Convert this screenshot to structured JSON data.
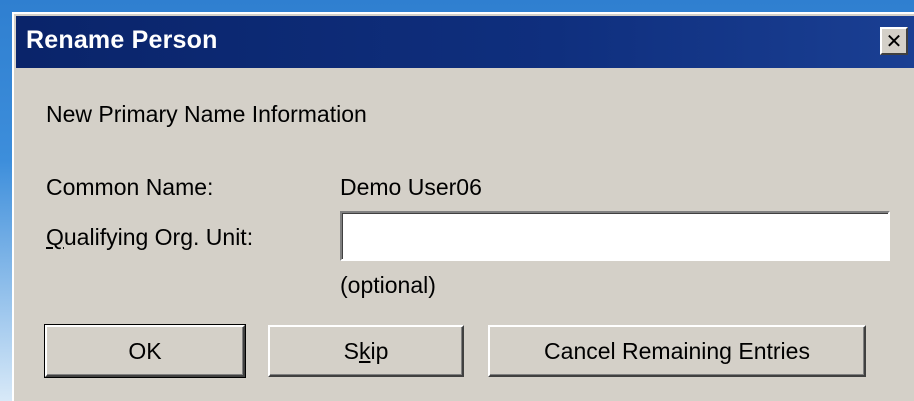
{
  "dialog": {
    "title": "Rename Person",
    "close_glyph": "✕",
    "section_heading": "New Primary Name Information",
    "common_name_label": "Common Name:",
    "common_name_value": "Demo User06",
    "qou_label_mnemonic": "Q",
    "qou_label_rest": "ualifying Org. Unit:",
    "qou_value": "",
    "optional_note": "(optional)"
  },
  "buttons": {
    "ok_label": "OK",
    "skip_pre": "S",
    "skip_mnemonic": "k",
    "skip_post": "ip",
    "cancel_label": "Cancel Remaining Entries"
  },
  "colors": {
    "titlebar": "#0a246a",
    "face": "#d4d0c8"
  }
}
